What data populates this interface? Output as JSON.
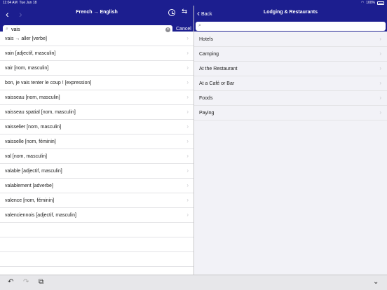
{
  "status_bar": {
    "time": "11:04 AM",
    "date": "Tue Jun 18",
    "wifi_icon": "wifi-icon",
    "battery": "100%"
  },
  "left_pane": {
    "title": "French → English",
    "search": {
      "value": "vais",
      "cancel_label": "Cancel"
    },
    "results": [
      "vais → aller [verbe]",
      "vain [adjectif, masculin]",
      "vair [nom, masculin]",
      "bon, je vais tenter le coup ! [expression]",
      "vaisseau [nom, masculin]",
      "vaisseau spatial [nom, masculin]",
      "vaisselier [nom, masculin]",
      "vaisselle [nom, féminin]",
      "val [nom, masculin]",
      "valable [adjectif, masculin]",
      "valablement [adverbe]",
      "valence [nom, féminin]",
      "valenciennois [adjectif, masculin]"
    ]
  },
  "right_pane": {
    "back_label": "Back",
    "title": "Lodging & Restaurants",
    "categories": [
      "Hotels",
      "Camping",
      "At the Restaurant",
      "At a Café or Bar",
      "Foods",
      "Paying"
    ]
  }
}
